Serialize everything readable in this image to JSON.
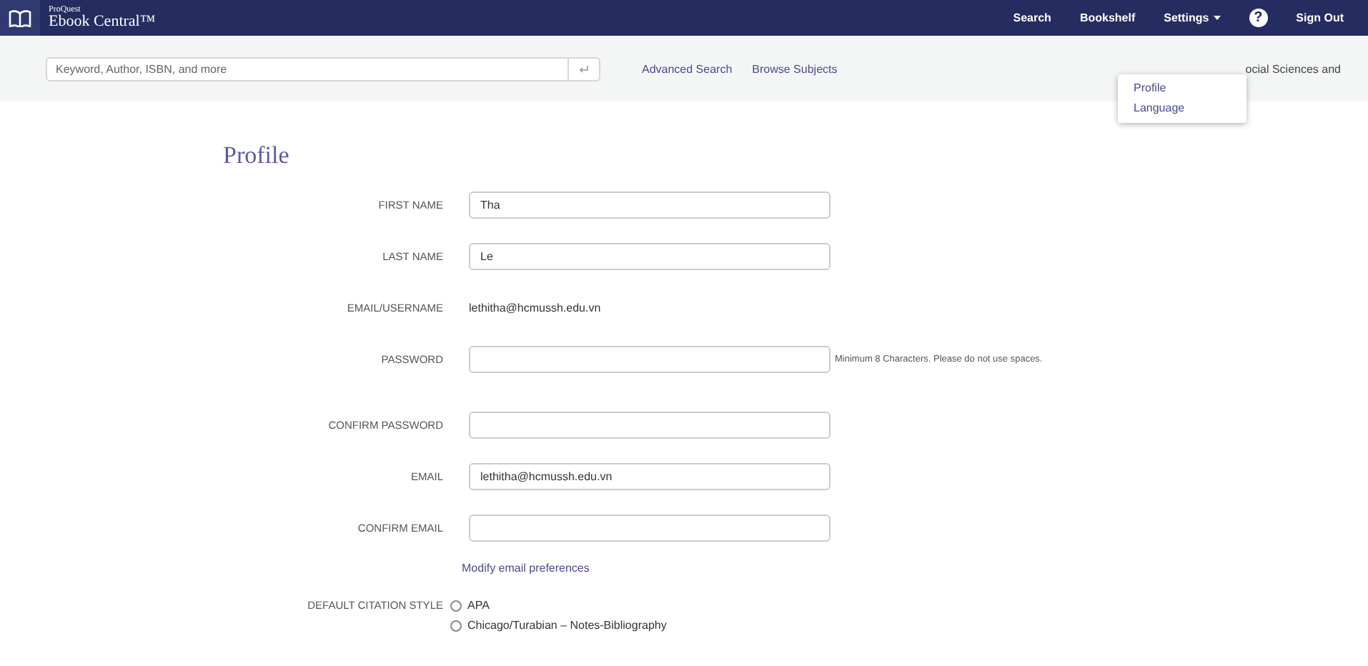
{
  "header": {
    "brand_top": "ProQuest",
    "brand_name": "Ebook Central™",
    "nav": [
      {
        "label": "Search",
        "kind": "link"
      },
      {
        "label": "Bookshelf",
        "kind": "link"
      },
      {
        "label": "Settings",
        "kind": "menu",
        "expanded": true
      },
      {
        "label": "?",
        "kind": "help"
      },
      {
        "label": "Sign Out",
        "kind": "link"
      }
    ]
  },
  "settings_menu": [
    {
      "label": "Profile"
    },
    {
      "label": "Language"
    }
  ],
  "search": {
    "placeholder": "Keyword, Author, ISBN, and more",
    "links": [
      "Advanced Search",
      "Browse Subjects"
    ],
    "side_text": "ocial Sciences and"
  },
  "profile": {
    "title": "Profile",
    "fields": [
      {
        "label": "FIRST NAME",
        "kind": "input",
        "value": "Tha"
      },
      {
        "label": "LAST NAME",
        "kind": "input",
        "value": "Le"
      },
      {
        "label": "EMAIL/USERNAME",
        "kind": "text",
        "value": "lethitha@hcmussh.edu.vn"
      },
      {
        "label": "PASSWORD",
        "kind": "input",
        "hint": "Minimum 8 Characters. Please do not use spaces."
      },
      {
        "label": "CONFIRM PASSWORD",
        "kind": "input"
      },
      {
        "label": "EMAIL",
        "kind": "input",
        "value": "lethitha@hcmussh.edu.vn"
      },
      {
        "label": "CONFIRM EMAIL",
        "kind": "input"
      }
    ],
    "email_link": "Modify email preferences",
    "citation": {
      "label": "DEFAULT CITATION STYLE",
      "options": [
        {
          "label": "APA",
          "selected": false
        },
        {
          "label": "Chicago/Turabian – Notes-Bibliography",
          "selected": false
        }
      ]
    }
  }
}
